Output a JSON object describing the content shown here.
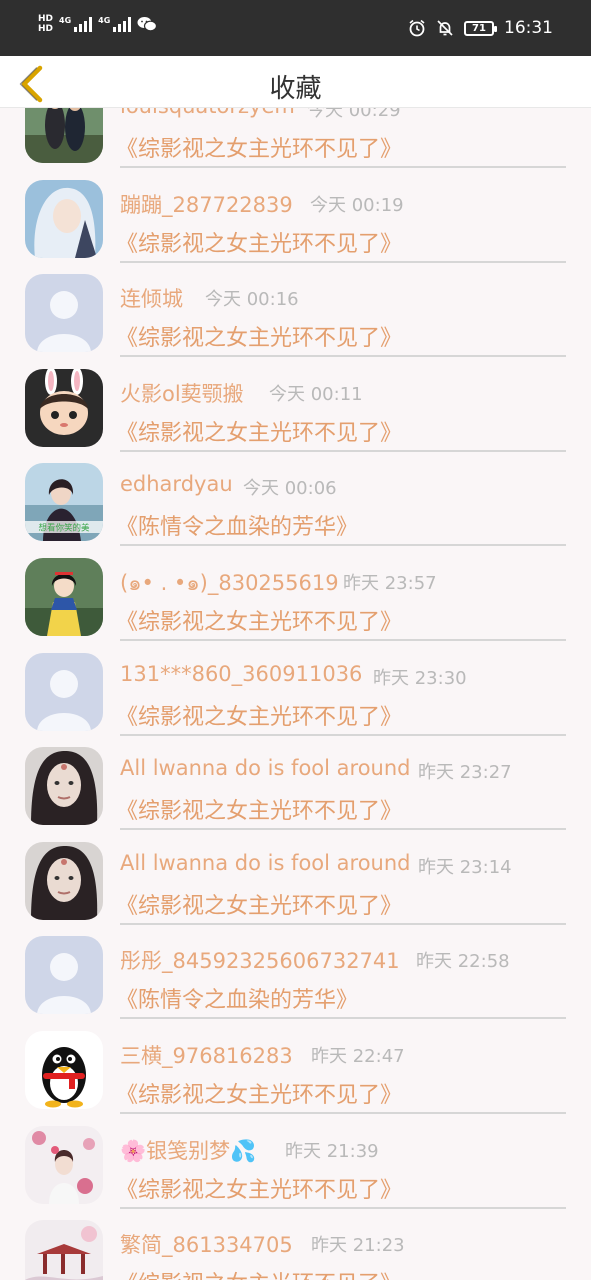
{
  "status_bar": {
    "hd1": "HD",
    "hd2": "HD",
    "net1": "4G",
    "net2": "4G",
    "battery": "71",
    "time": "16:31",
    "icons": [
      "alarm-icon",
      "bell-off-icon",
      "wechat-icon"
    ]
  },
  "nav": {
    "title": "收藏",
    "back_icon": "chevron-left-icon",
    "accent": "#d9a400"
  },
  "colors": {
    "name": "#e8a87c",
    "title": "#e49f6e",
    "time": "#b9b9b9",
    "background": "#faf6f7"
  },
  "favorites": [
    {
      "user": "louisquatorzyem",
      "time": "今天 00:29",
      "title": "《综影视之女主光环不见了》",
      "avatar": "photo-couple"
    },
    {
      "user": "蹦蹦_287722839",
      "time": "今天 00:19",
      "title": "《综影视之女主光环不见了》",
      "avatar": "anime-silver-hair"
    },
    {
      "user": "连倾城",
      "time": "今天 00:16",
      "title": "《综影视之女主光环不见了》",
      "avatar": "default-avatar"
    },
    {
      "user": "火影ol葜颚搬",
      "time": "今天 00:11",
      "title": "《综影视之女主光环不见了》",
      "avatar": "cartoon-bunny"
    },
    {
      "user": "edhardyau",
      "time": "今天 00:06",
      "title": "《陈情令之血染的芳华》",
      "avatar": "photo-girl-lake",
      "avatar_caption": "想看你笑的美"
    },
    {
      "user": "(๑• . •๑)_830255619",
      "time": "昨天 23:57",
      "title": "《综影视之女主光环不见了》",
      "avatar": "cartoon-princess"
    },
    {
      "user": "131***860_360911036",
      "time": "昨天 23:30",
      "title": "《综影视之女主光环不见了》",
      "avatar": "default-avatar"
    },
    {
      "user": "All lwanna do is fool around",
      "time": "昨天 23:27",
      "title": "《综影视之女主光环不见了》",
      "avatar": "photo-selfie"
    },
    {
      "user": "All lwanna do is fool around",
      "time": "昨天 23:14",
      "title": "《综影视之女主光环不见了》",
      "avatar": "photo-selfie"
    },
    {
      "user": "彤彤_84592325606732741",
      "time": "昨天 22:58",
      "title": "《陈情令之血染的芳华》",
      "avatar": "default-avatar"
    },
    {
      "user": "三横_976816283",
      "time": "昨天 22:47",
      "title": "《综影视之女主光环不见了》",
      "avatar": "qq-penguin"
    },
    {
      "user": "🌸银笺别梦💦",
      "time": "昨天 21:39",
      "title": "《综影视之女主光环不见了》",
      "avatar": "photo-flowers"
    },
    {
      "user": "繁简_861334705",
      "time": "昨天 21:23",
      "title": "《综影视之女主光环不见了》",
      "avatar": "painting-pavilion"
    }
  ]
}
